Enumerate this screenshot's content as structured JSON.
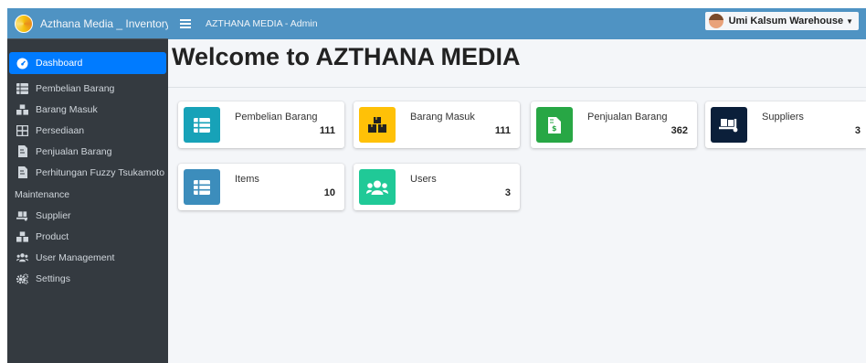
{
  "brand": {
    "title": "Azthana Media _ Inventory"
  },
  "topbar": {
    "title": "AZTHANA MEDIA - Admin",
    "user": "Umi Kalsum Warehouse"
  },
  "sidebar": {
    "items": [
      {
        "label": "Dashboard",
        "icon": "dashboard-icon"
      },
      {
        "label": "Pembelian Barang",
        "icon": "list-icon"
      },
      {
        "label": "Barang Masuk",
        "icon": "boxes-icon"
      },
      {
        "label": "Persediaan",
        "icon": "table-icon"
      },
      {
        "label": "Penjualan Barang",
        "icon": "invoice-icon"
      },
      {
        "label": "Perhitungan Fuzzy Tsukamoto",
        "icon": "invoice-icon"
      }
    ],
    "section_header": "Maintenance",
    "maintenance_items": [
      {
        "label": "Supplier",
        "icon": "dolly-icon"
      },
      {
        "label": "Product",
        "icon": "boxes-icon"
      },
      {
        "label": "User Management",
        "icon": "users-icon"
      },
      {
        "label": "Settings",
        "icon": "cogs-icon"
      }
    ]
  },
  "main": {
    "title": "Welcome to AZTHANA MEDIA",
    "cards": [
      {
        "label": "Pembelian Barang",
        "value": "111",
        "color": "#17a2b8",
        "icon": "list-icon"
      },
      {
        "label": "Barang Masuk",
        "value": "111",
        "color": "#ffc107",
        "icon": "boxes-icon"
      },
      {
        "label": "Penjualan Barang",
        "value": "362",
        "color": "#28a745",
        "icon": "invoice-icon"
      },
      {
        "label": "Suppliers",
        "value": "3",
        "color": "#0b1f3a",
        "icon": "dolly-icon"
      },
      {
        "label": "Items",
        "value": "10",
        "color": "#3c8dbc",
        "icon": "list-icon"
      },
      {
        "label": "Users",
        "value": "3",
        "color": "#20c997",
        "icon": "users-icon"
      }
    ]
  },
  "colors": {
    "topbar": "#4f93c3",
    "sidebar": "#343a40",
    "active": "#007bff"
  }
}
